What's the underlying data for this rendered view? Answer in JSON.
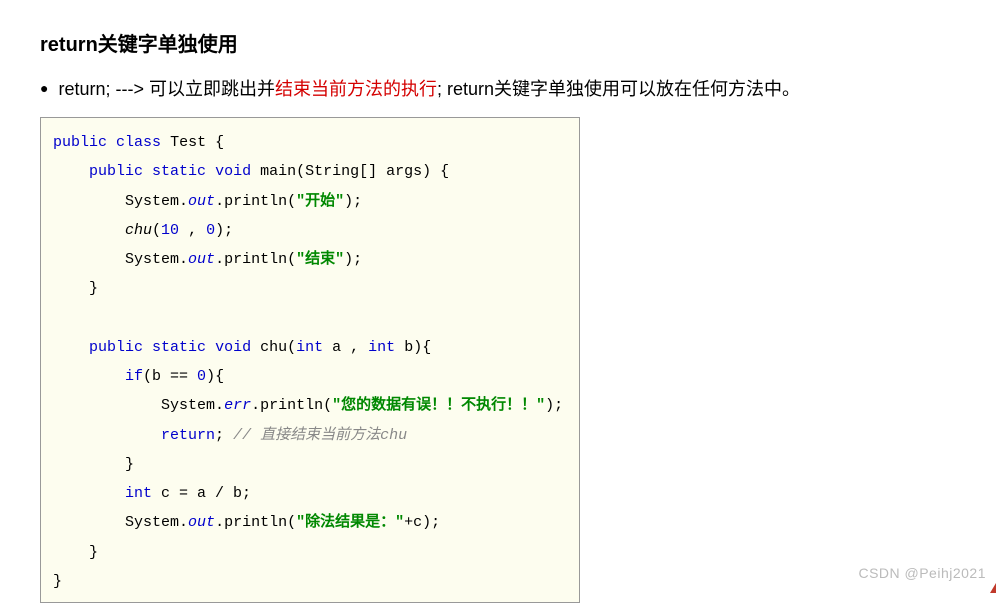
{
  "heading": "return关键字单独使用",
  "bullet": {
    "prefix": "return;    --->    可以立即跳出并",
    "highlight": "结束当前方法的执行",
    "suffix": ";    return关键字单独使用可以放在任何方法中。"
  },
  "code": {
    "kw_public": "public",
    "kw_class": "class",
    "kw_static": "static",
    "kw_void": "void",
    "kw_int": "int",
    "kw_if": "if",
    "kw_return": "return",
    "cls": "Test",
    "main": "main",
    "chu_name": "chu",
    "sig_main_args": "(String[] args) {",
    "sig_chu_args": "(",
    "sig_chu_sep": " a , ",
    "sig_chu_tail": " b){",
    "system": "System",
    "out": "out",
    "err": "err",
    "println": ".println(",
    "close_call": ");",
    "str_start": "\"开始\"",
    "str_end": "\"结束\"",
    "str_warn": "\"您的数据有误！！不执行！！\"",
    "str_result": "\"除法结果是：\"",
    "chu_call_open": "(",
    "num_10": "10",
    "sep_numargs": " , ",
    "num_0": "0",
    "chu_call_close": ");",
    "if_cond": "(b == ",
    "if_tail": "){",
    "return_line_tail": ";",
    "comment_return": " // 直接结束当前方法chu",
    "assign_c": "            ",
    "expr_c": " c = a / b;",
    "plus_c": "+c);",
    "brace_close": "}",
    "brace_open": " {"
  },
  "watermark": "CSDN @Peihj2021"
}
